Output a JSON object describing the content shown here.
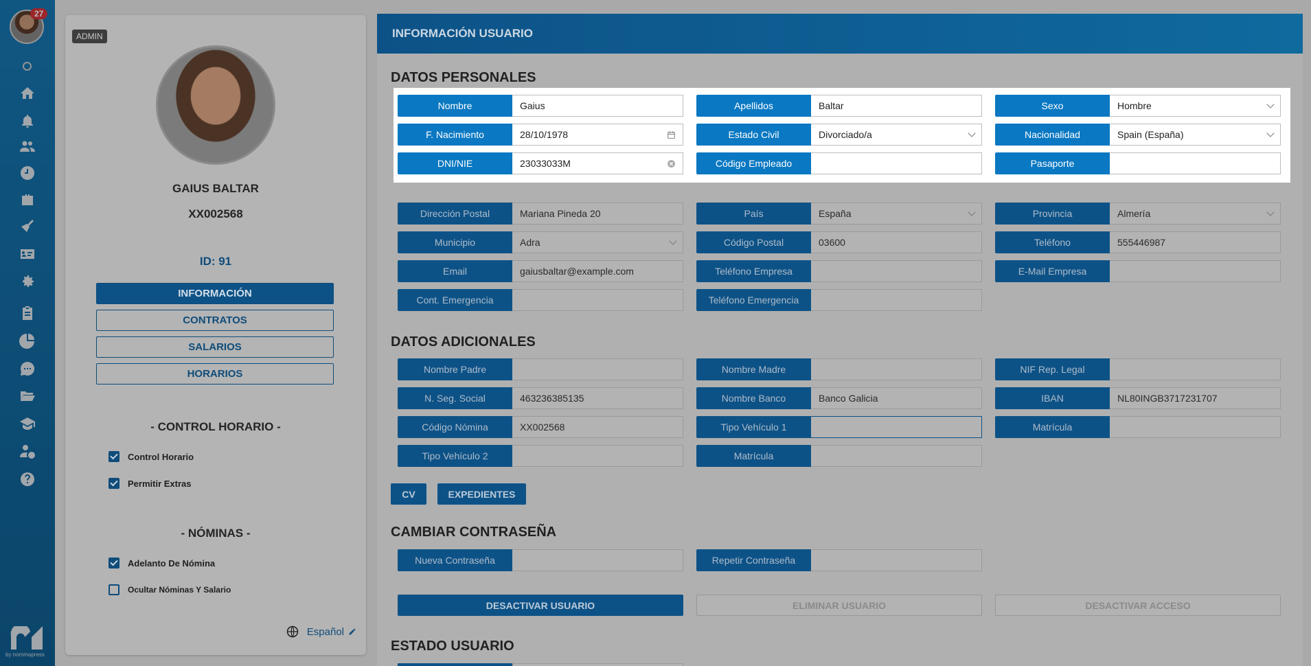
{
  "sidebar": {
    "notification_count": "27",
    "icons": [
      "home-icon",
      "bell-icon",
      "users-icon",
      "clock-icon",
      "briefcase-icon",
      "broom-icon",
      "id-card-icon",
      "gear-icon",
      "clipboard-icon",
      "pie-chart-icon",
      "chat-icon",
      "folder-icon",
      "graduation-cap-icon",
      "user-money-icon",
      "help-icon"
    ],
    "logo_text": "by nommapress"
  },
  "profile": {
    "role": "ADMIN",
    "name": "GAIUS BALTAR",
    "code": "XX002568",
    "id_label": "ID: 91",
    "tabs": [
      {
        "label": "INFORMACIÓN",
        "active": true
      },
      {
        "label": "CONTRATOS",
        "active": false
      },
      {
        "label": "SALARIOS",
        "active": false
      },
      {
        "label": "HORARIOS",
        "active": false
      }
    ],
    "control_title": "- CONTROL HORARIO -",
    "control_items": [
      {
        "label": "Control Horario",
        "checked": true
      },
      {
        "label": "Permitir Extras",
        "checked": true
      }
    ],
    "nominas_title": "- NÓMINAS -",
    "nominas_items": [
      {
        "label": "Adelanto De Nómina",
        "checked": true
      },
      {
        "label": "Ocultar Nóminas Y Salario",
        "checked": false
      }
    ],
    "language": "Español"
  },
  "main": {
    "header": "INFORMACIÓN USUARIO",
    "personal_title": "DATOS PERSONALES",
    "personal": [
      {
        "label": "Nombre",
        "value": ""
      },
      {
        "label": "Apellidos",
        "value": "Baltar"
      },
      {
        "label": "Sexo",
        "value": "Hombre"
      },
      {
        "label": "F. Nacimiento",
        "value": "28/10/1978"
      },
      {
        "label": "Estado Civil",
        "value": "Divorciado/a"
      },
      {
        "label": "Nacionalidad",
        "value": "Spain (España)"
      },
      {
        "label": "DNI/NIE",
        "value": "23033033M"
      },
      {
        "label": "Código Empleado",
        "value": ""
      },
      {
        "label": "Pasaporte",
        "value": ""
      }
    ],
    "nombre_value": "Gaius",
    "address": [
      {
        "label": "Dirección Postal",
        "value": "Mariana Pineda 20"
      },
      {
        "label": "País",
        "value": "España"
      },
      {
        "label": "Provincia",
        "value": "Almería"
      },
      {
        "label": "Municipio",
        "value": "Adra"
      },
      {
        "label": "Código Postal",
        "value": "03600"
      },
      {
        "label": "Teléfono",
        "value": "555446987"
      },
      {
        "label": "Email",
        "value": "gaiusbaltar@example.com"
      },
      {
        "label": "Teléfono Empresa",
        "value": ""
      },
      {
        "label": "E-Mail Empresa",
        "value": ""
      },
      {
        "label": "Cont. Emergencia",
        "value": ""
      },
      {
        "label": "Teléfono Emergencia",
        "value": ""
      }
    ],
    "additional_title": "DATOS ADICIONALES",
    "additional": [
      {
        "label": "Nombre Padre",
        "value": ""
      },
      {
        "label": "Nombre Madre",
        "value": ""
      },
      {
        "label": "NIF Rep. Legal",
        "value": ""
      },
      {
        "label": "N. Seg. Social",
        "value": "463236385135"
      },
      {
        "label": "Nombre Banco",
        "value": "Banco Galicia"
      },
      {
        "label": "IBAN",
        "value": "NL80INGB3717231707"
      },
      {
        "label": "Código Nómina",
        "value": "XX002568"
      },
      {
        "label": "Tipo Vehículo 1",
        "value": ""
      },
      {
        "label": "Matrícula",
        "value": ""
      },
      {
        "label": "Tipo Vehículo 2",
        "value": ""
      },
      {
        "label": "Matrícula",
        "value": ""
      }
    ],
    "cv_label": "CV",
    "expedientes_label": "EXPEDIENTES",
    "password_title": "CAMBIAR CONTRASEÑA",
    "new_password_label": "Nueva Contraseña",
    "repeat_password_label": "Repetir Contraseña",
    "deactivate_user": "DESACTIVAR USUARIO",
    "delete_user": "ELIMINAR USUARIO",
    "deactivate_access": "DESACTIVAR ACCESO",
    "status_title": "ESTADO USUARIO"
  }
}
